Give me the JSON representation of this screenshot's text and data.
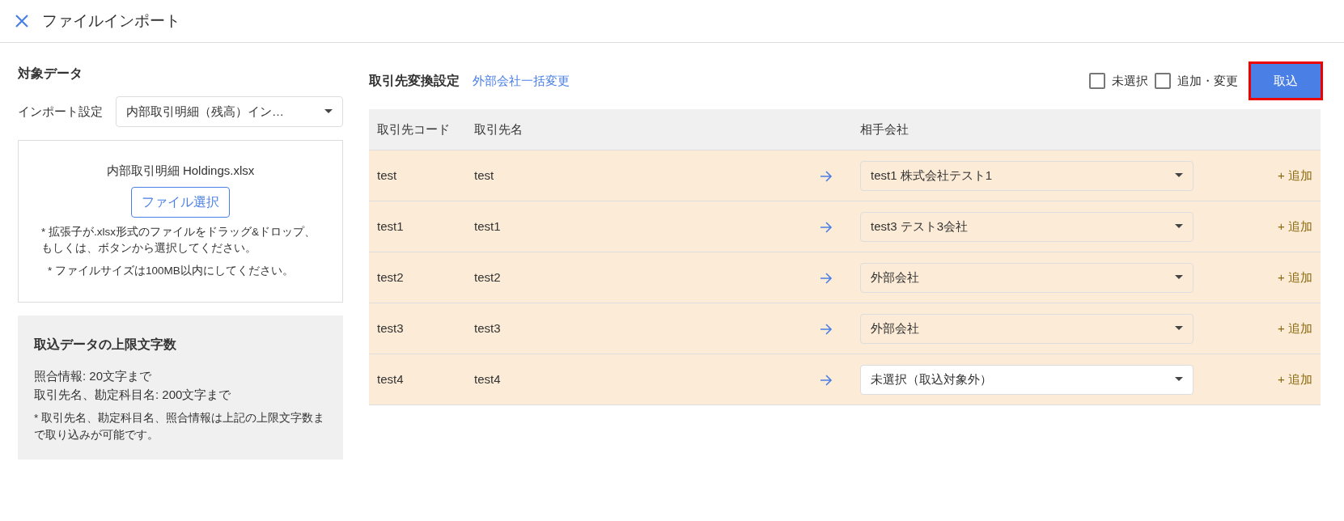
{
  "window": {
    "title": "ファイルインポート"
  },
  "target_data": {
    "heading": "対象データ",
    "import_setting": {
      "label": "インポート設定",
      "value": "内部取引明細（残高）イン…"
    },
    "drop_zone": {
      "file_name": "内部取引明細 Holdings.xlsx",
      "button": "ファイル選択",
      "notes": [
        "* 拡張子が.xlsx形式のファイルをドラッグ&ドロップ、もしくは、ボタンから選択してください。",
        "* ファイルサイズは100MB以内にしてください。"
      ]
    },
    "limits": {
      "heading": "取込データの上限文字数",
      "lines": [
        "照合情報: 20文字まで",
        "取引先名、勘定科目名: 200文字まで"
      ],
      "note": "* 取引先名、勘定科目名、照合情報は上記の上限文字数まで取り込みが可能です。"
    }
  },
  "conversion": {
    "heading": "取引先変換設定",
    "bulk_link": "外部会社一括変更",
    "filters": [
      {
        "label": "未選択",
        "checked": false
      },
      {
        "label": "追加・変更",
        "checked": false
      }
    ],
    "import_button": {
      "label": "取込",
      "highlighted": true
    },
    "table": {
      "columns": [
        "取引先コード",
        "取引先名",
        "相手会社"
      ],
      "rows": [
        {
          "code": "test",
          "name": "test",
          "partner": "test1 株式会社テスト1",
          "mapped": true,
          "add": "+ 追加"
        },
        {
          "code": "test1",
          "name": "test1",
          "partner": "test3 テスト3会社",
          "mapped": true,
          "add": "+ 追加"
        },
        {
          "code": "test2",
          "name": "test2",
          "partner": "外部会社",
          "mapped": true,
          "add": "+ 追加"
        },
        {
          "code": "test3",
          "name": "test3",
          "partner": "外部会社",
          "mapped": true,
          "add": "+ 追加"
        },
        {
          "code": "test4",
          "name": "test4",
          "partner": "未選択（取込対象外）",
          "mapped": false,
          "add": "+ 追加"
        }
      ]
    }
  }
}
